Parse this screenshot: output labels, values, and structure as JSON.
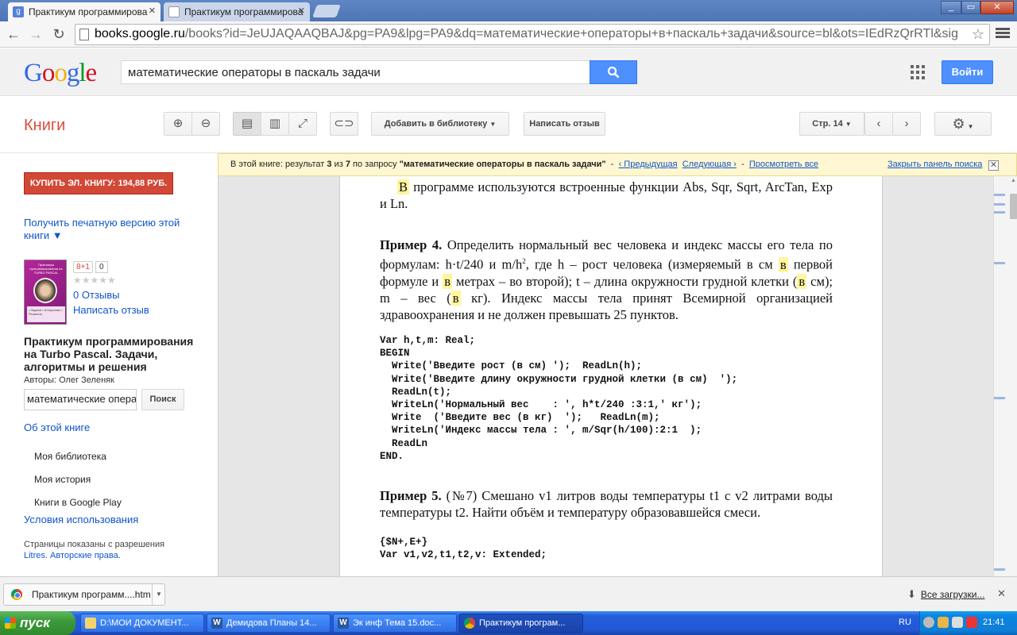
{
  "browser": {
    "tabs": [
      {
        "title": "Практикум программирова"
      },
      {
        "title": "Практикум программирова"
      }
    ],
    "url_host": "books.google.ru",
    "url_rest": "/books?id=JeUJAQAAQBAJ&pg=PA9&lpg=PA9&dq=математические+операторы+в+паскаль+задачи&source=bl&ots=IEdRzQrRTl&sig",
    "window_controls": {
      "minimize": "_",
      "maximize": "▭",
      "close": "✕"
    }
  },
  "google": {
    "search_value": "математические операторы в паскаль задачи",
    "signin_label": "Войти"
  },
  "books_toolbar": {
    "title": "Книги",
    "add_library": "Добавить в библиотеку",
    "write_review": "Написать отзыв",
    "page_label": "Стр. 14",
    "colors": {
      "accent": "#dd4b39",
      "link": "#1155cc",
      "buy": "#d14836"
    }
  },
  "sidebar": {
    "buy_label": "КУПИТЬ ЭЛ. КНИГУ: 194,88 РУБ.",
    "print_version": "Получить печатную версию этой книги ▼",
    "gplus_label": "8+1",
    "gplus_count": "0",
    "stars": "★★★★★",
    "reviews": "0 Отзывы",
    "write_review": "Написать отзыв",
    "book_title": "Практикум программирования на Turbo Pascal. Задачи, алгоритмы и решения",
    "authors": "Авторы: Олег Зеленяк",
    "inbook_search_value": "математические операторы в паскаль задачи",
    "inbook_search_btn": "Поиск",
    "about_book": "Об этой книге",
    "my_library": "Моя библиотека",
    "my_history": "Моя история",
    "books_play": "Книги в Google Play",
    "terms": "Условия использования",
    "perm_text": "Страницы показаны с разрешения",
    "perm_link": "Litres. Авторские права."
  },
  "resultbar": {
    "prefix": "В этой книге: результат",
    "current": "3",
    "of": "из",
    "total": "7",
    "query_prefix": "по запросу",
    "query": "\"математические операторы в паскаль задачи\"",
    "dash": "-",
    "prev": "‹ Предыдущая",
    "next": "Следующая ›",
    "sep": "-",
    "view_all": "Просмотреть все",
    "close_panel": "Закрыть панель поиска",
    "close_x": "✕"
  },
  "page": {
    "para1_hl": "В",
    "para1": " программе используются встроенные функции Abs, Sqr, Sqrt, ArcTan, Exp и Ln.",
    "ex4_label": "Пример 4.",
    "ex4_a": " Определить нормальный вес человека и индекс массы его тела по формулам:  h·t/240  и  m/h",
    "ex4_sup": "2",
    "ex4_b": ",  где h – рост человека (измеряемый в см ",
    "hl_v": "в",
    "ex4_c": " первой формуле и ",
    "ex4_d": " метрах – во второй); t – длина окружности грудной клетки (",
    "ex4_e": " см); m – вес (",
    "ex4_f": " кг). Индекс массы тела принят Всемирной организацией здравоохранения и не должен превышать 25 пунктов.",
    "code4": [
      "Var h,t,m: Real;",
      "BEGIN",
      "  Write('Введите рост (в см) ');  ReadLn(h);",
      "  Write('Введите длину окружности грудной клетки (в см)  ');",
      "  ReadLn(t);",
      "  WriteLn('Нормальный вес    : ', h*t/240 :3:1,' кг');",
      "  Write  ('Введите вес (в кг)  ');   ReadLn(m);",
      "  WriteLn('Индекс массы тела : ', m/Sqr(h/100):2:1  );",
      "  ReadLn",
      "END."
    ],
    "ex5_label": "Пример 5.",
    "ex5": "  (№7)  Смешано v1 литров воды температуры t1 с v2 литрами воды температуры t2.  Найти объём и температуру образовавшейся смеси.",
    "code5": [
      "{$N+,E+}",
      "Var v1,v2,t1,t2,v: Extended;"
    ]
  },
  "downloads": {
    "file": "Практикум программ....htm",
    "all": "Все загрузки...",
    "close": "✕"
  },
  "taskbar": {
    "start": "пуск",
    "tasks": [
      {
        "label": "D:\\МОИ ДОКУМЕНТ...",
        "icon": "folder-icon"
      },
      {
        "label": "Демидова Планы 14...",
        "icon": "word-icon"
      },
      {
        "label": "Эк инф Тема 15.doc...",
        "icon": "word-icon"
      },
      {
        "label": "Практикум програм...",
        "icon": "chrome-icon"
      }
    ],
    "lang": "RU",
    "clock": "21:41"
  }
}
